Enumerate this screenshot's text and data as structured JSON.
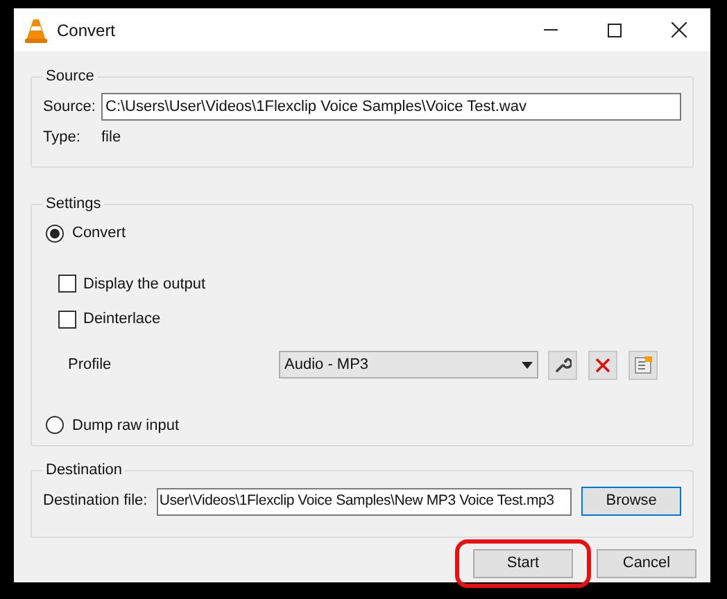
{
  "window": {
    "title": "Convert"
  },
  "source": {
    "group_title": "Source",
    "source_label": "Source:",
    "source_value": "C:\\Users\\User\\Videos\\1Flexclip Voice Samples\\Voice Test.wav",
    "type_label": "Type:",
    "type_value": "file"
  },
  "settings": {
    "group_title": "Settings",
    "convert": {
      "label": "Convert",
      "selected": true
    },
    "options": [
      {
        "label": "Display the output",
        "checked": false
      },
      {
        "label": "Deinterlace",
        "checked": false
      }
    ],
    "profile_label": "Profile",
    "profile_value": "Audio - MP3",
    "dump": {
      "label": "Dump raw input",
      "selected": false
    }
  },
  "destination": {
    "group_title": "Destination",
    "label": "Destination file:",
    "value": "User\\Videos\\1Flexclip Voice Samples\\New MP3 Voice Test.mp3",
    "browse": "Browse"
  },
  "buttons": [
    {
      "label": "Start",
      "highlighted": true
    },
    {
      "label": "Cancel",
      "highlighted": false
    }
  ]
}
